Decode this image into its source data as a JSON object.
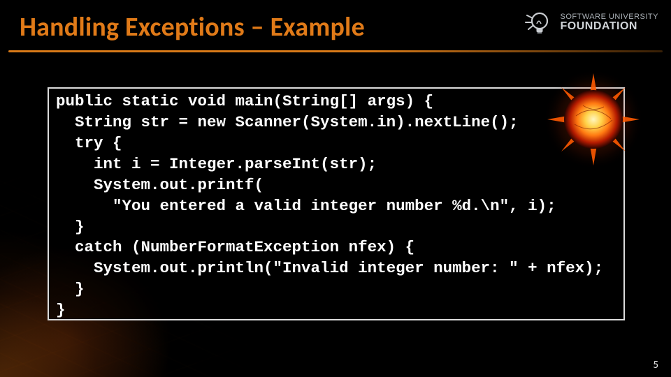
{
  "title": "Handling Exceptions – Example",
  "logo": {
    "line1": "SOFTWARE UNIVERSITY",
    "line2": "FOUNDATION"
  },
  "code": "public static void main(String[] args) {\n  String str = new Scanner(System.in).nextLine();\n  try {\n    int i = Integer.parseInt(str);\n    System.out.printf(\n      \"You entered a valid integer number %d.\\n\", i);\n  }\n  catch (NumberFormatException nfex) {\n    System.out.println(\"Invalid integer number: \" + nfex);\n  }\n}",
  "page_number": "5"
}
